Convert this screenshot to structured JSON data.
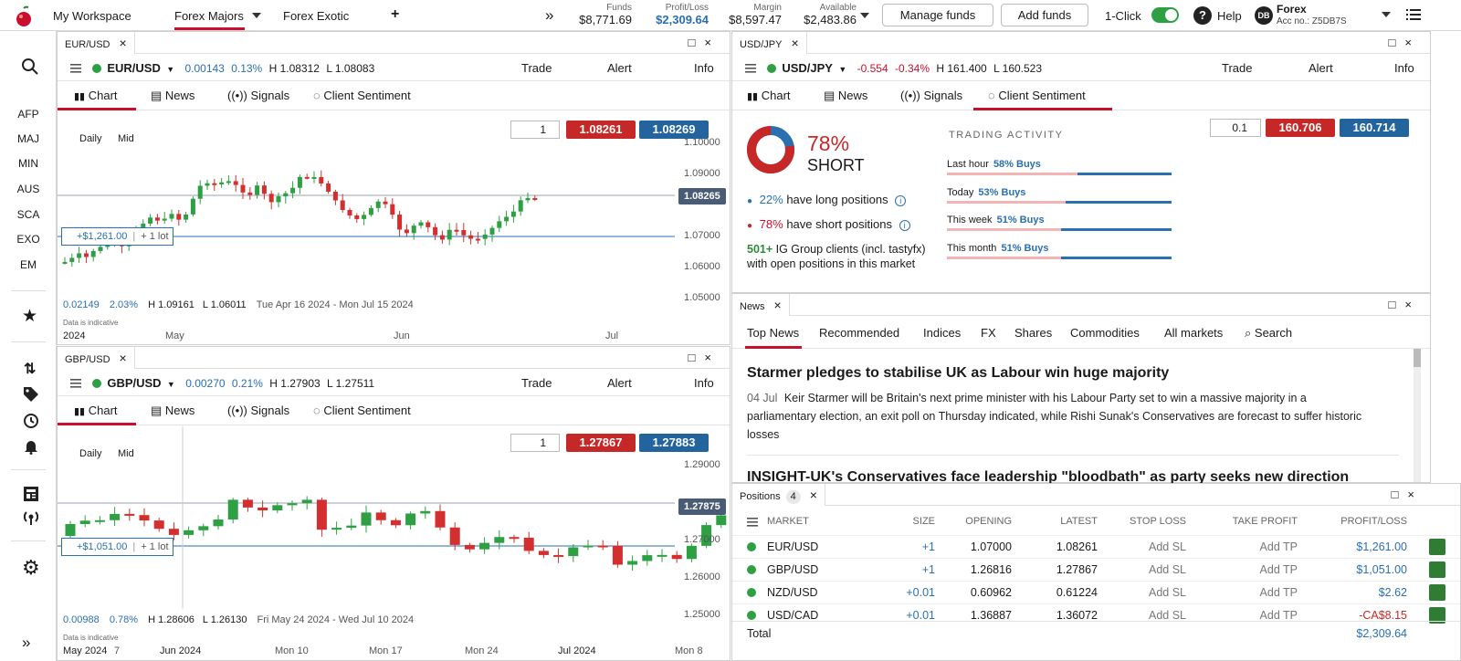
{
  "topbar": {
    "workspace": "My Workspace",
    "tab_active": "Forex Majors",
    "tab_2": "Forex Exotic",
    "add_tab": "+",
    "overflow": "»",
    "funds_label": "Funds",
    "funds": "$8,771.69",
    "pl_label": "Profit/Loss",
    "pl": "$2,309.64",
    "margin_label": "Margin",
    "margin": "$8,597.47",
    "available_label": "Available",
    "available": "$2,483.86",
    "manage_funds": "Manage funds",
    "add_funds": "Add funds",
    "one_click": "1-Click",
    "help": "Help",
    "avatar": "DB",
    "account_name": "Forex",
    "account_no": "Acc no.: Z5DB7S"
  },
  "sidebar": {
    "groups": [
      "AFP",
      "MAJ",
      "MIN",
      "AUS",
      "SCA",
      "EXO",
      "EM"
    ],
    "collapse": "»"
  },
  "panel_eurusd": {
    "tab": "EUR/USD",
    "market": "EUR/USD",
    "change": "0.00143",
    "change_pct": "0.13%",
    "high": "H 1.08312",
    "low": "L 1.08083",
    "trade": "Trade",
    "alert": "Alert",
    "info": "Info",
    "tabs": [
      "Chart",
      "News",
      "Signals",
      "Client Sentiment"
    ],
    "qty": "1",
    "sell": "1.08261",
    "buy": "1.08269",
    "interval": "Daily",
    "price_type": "Mid",
    "last_price_tag": "1.08265",
    "position_tag": "+$1,261.00",
    "position_lot": "+ 1 lot",
    "footer_change": "0.02149",
    "footer_pct": "2.03%",
    "footer_high": "H 1.09161",
    "footer_low": "L 1.06011",
    "footer_range": "Tue Apr 16 2024 - Mon Jul 15 2024",
    "disclaimer": "Data is indicative",
    "yticks": [
      "1.10000",
      "1.09000",
      "1.08000",
      "1.07000",
      "1.06000",
      "1.05000"
    ],
    "xticks": [
      "2024",
      "May",
      "Jun",
      "Jul"
    ]
  },
  "panel_gbpusd": {
    "tab": "GBP/USD",
    "market": "GBP/USD",
    "change": "0.00270",
    "change_pct": "0.21%",
    "high": "H 1.27903",
    "low": "L 1.27511",
    "trade": "Trade",
    "alert": "Alert",
    "info": "Info",
    "tabs": [
      "Chart",
      "News",
      "Signals",
      "Client Sentiment"
    ],
    "qty": "1",
    "sell": "1.27867",
    "buy": "1.27883",
    "interval": "Daily",
    "price_type": "Mid",
    "last_price_tag": "1.27875",
    "position_tag": "+$1,051.00",
    "position_lot": "+ 1 lot",
    "footer_change": "0.00988",
    "footer_pct": "0.78%",
    "footer_high": "H 1.28606",
    "footer_low": "L 1.26130",
    "footer_range": "Fri May 24 2024 - Wed Jul 10 2024",
    "disclaimer": "Data is indicative",
    "yticks": [
      "1.29000",
      "1.28000",
      "1.27000",
      "1.26000",
      "1.25000"
    ],
    "xticks": [
      "May 2024",
      "7",
      "Jun 2024",
      "Mon 10",
      "Mon 17",
      "Mon 24",
      "Jul 2024",
      "Mon 8"
    ]
  },
  "panel_usdjpy": {
    "tab": "USD/JPY",
    "market": "USD/JPY",
    "change": "-0.554",
    "change_pct": "-0.34%",
    "high": "H 161.400",
    "low": "L 160.523",
    "trade": "Trade",
    "alert": "Alert",
    "info": "Info",
    "tabs": [
      "Chart",
      "News",
      "Signals",
      "Client Sentiment"
    ],
    "qty": "0.1",
    "sell": "160.706",
    "buy": "160.714",
    "sentiment_pct": "78%",
    "sentiment_side": "SHORT",
    "long_pct": "22%",
    "long_text": "have long positions",
    "short_pct": "78%",
    "short_text": "have short positions",
    "clients_count": "501+",
    "clients_text": "IG Group clients (incl. tastyfx) with open positions in this market",
    "activity_title": "TRADING ACTIVITY",
    "activity": [
      {
        "label": "Last hour",
        "value": "58% Buys",
        "buys": 0.58
      },
      {
        "label": "Today",
        "value": "53% Buys",
        "buys": 0.53
      },
      {
        "label": "This week",
        "value": "51% Buys",
        "buys": 0.51
      },
      {
        "label": "This month",
        "value": "51% Buys",
        "buys": 0.51
      }
    ]
  },
  "news": {
    "tab": "News",
    "tabs": [
      "Top News",
      "Recommended",
      "Indices",
      "FX",
      "Shares",
      "Commodities",
      "All markets"
    ],
    "search": "Search",
    "headline1": "Starmer pledges to stabilise UK as Labour win huge majority",
    "date1": "04 Jul",
    "body1": "Keir Starmer will be Britain's next prime minister with his Labour Party set to win a massive majority in a parliamentary election, an exit poll on Thursday indicated, while Rishi Sunak's Conservatives are forecast to suffer historic losses",
    "headline2": "INSIGHT-UK's Conservatives face leadership \"bloodbath\" as party seeks new direction"
  },
  "positions": {
    "tab": "Positions",
    "count": "4",
    "headers": [
      "MARKET",
      "SIZE",
      "OPENING",
      "LATEST",
      "STOP LOSS",
      "TAKE PROFIT",
      "PROFIT/LOSS"
    ],
    "rows": [
      {
        "market": "EUR/USD",
        "size": "+1",
        "opening": "1.07000",
        "latest": "1.08261",
        "sl": "Add SL",
        "tp": "Add TP",
        "pl": "$1,261.00"
      },
      {
        "market": "GBP/USD",
        "size": "+1",
        "opening": "1.26816",
        "latest": "1.27867",
        "sl": "Add SL",
        "tp": "Add TP",
        "pl": "$1,051.00"
      },
      {
        "market": "NZD/USD",
        "size": "+0.01",
        "opening": "0.60962",
        "latest": "0.61224",
        "sl": "Add SL",
        "tp": "Add TP",
        "pl": "$2.62"
      },
      {
        "market": "USD/CAD",
        "size": "+0.01",
        "opening": "1.36887",
        "latest": "1.36072",
        "sl": "Add SL",
        "tp": "Add TP",
        "pl": "-CA$8.15"
      }
    ],
    "total_label": "Total",
    "total": "$2,309.64"
  },
  "colors": {
    "accent": "#c8102e",
    "up": "#2ea043",
    "down": "#d32f2f",
    "link": "#2a6fb0"
  }
}
